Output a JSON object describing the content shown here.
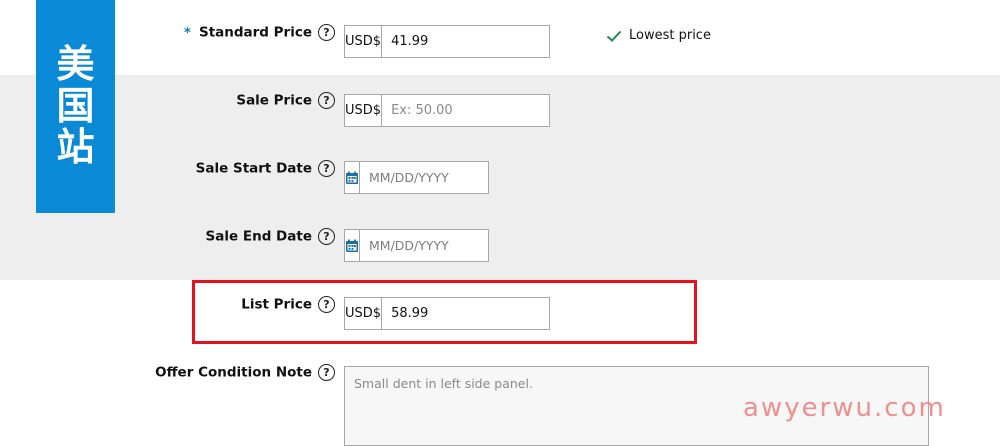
{
  "badge": {
    "chars": [
      "美",
      "国",
      "站"
    ]
  },
  "fields": {
    "standard_price": {
      "required_mark": "*",
      "label": "Standard Price",
      "currency": "USD$",
      "value": "41.99",
      "status": "Lowest price"
    },
    "sale_price": {
      "label": "Sale Price",
      "currency": "USD$",
      "placeholder": "Ex: 50.00"
    },
    "sale_start_date": {
      "label": "Sale Start Date",
      "placeholder": "MM/DD/YYYY"
    },
    "sale_end_date": {
      "label": "Sale End Date",
      "placeholder": "MM/DD/YYYY"
    },
    "list_price": {
      "label": "List Price",
      "currency": "USD$",
      "value": "58.99"
    },
    "offer_condition_note": {
      "label": "Offer Condition Note",
      "placeholder": "Small dent in left side panel."
    }
  },
  "help_symbol": "?",
  "watermark": "awyerwu.com",
  "colors": {
    "badge": "#0a8ad6",
    "highlight": "#e3141d",
    "check": "#1d8a52",
    "band": "#eeeeee"
  },
  "icons": [
    "question-circle-icon",
    "calendar-icon",
    "check-icon"
  ]
}
